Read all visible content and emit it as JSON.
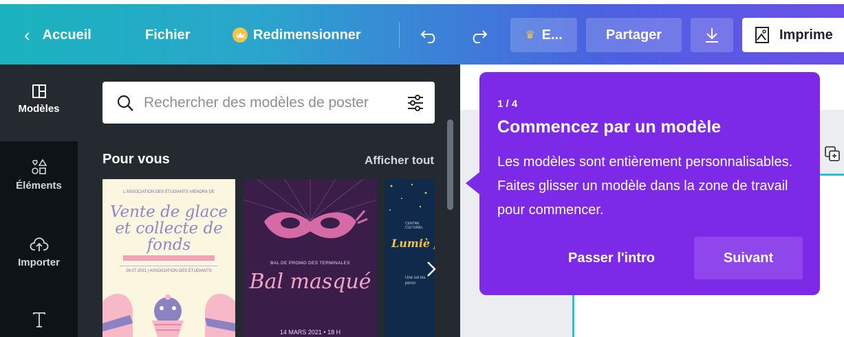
{
  "topbar": {
    "back_label": "Accueil",
    "file_label": "Fichier",
    "resize_label": "Redimensionner",
    "e_label": "E...",
    "share_label": "Partager",
    "print_label": "Imprime"
  },
  "rail": {
    "items": [
      {
        "label": "Modèles",
        "icon": "templates-icon"
      },
      {
        "label": "Éléments",
        "icon": "elements-icon"
      },
      {
        "label": "Importer",
        "icon": "upload-cloud-icon"
      },
      {
        "label": "",
        "icon": "text-icon"
      }
    ]
  },
  "panel": {
    "search_placeholder": "Rechercher des modèles de poster",
    "section_title": "Pour vous",
    "see_all": "Afficher tout",
    "templates": [
      {
        "top_small": "L'ASSOCIATION DES ÉTUDIANTS VIENDRA DE",
        "script": "Vente de glace et collecte de fonds",
        "info": "26.07.2021 | ASSOCIATION DES ÉTUDIANTS"
      },
      {
        "subtitle": "BAL DE PROMO DES TERMINALES",
        "title": "Bal masqué",
        "date": "14 MARS 2021 • 18 H"
      },
      {
        "small": "CENTRE CULTUREL",
        "title": "Lumiè faib",
        "body": "Une soi les perso"
      }
    ]
  },
  "tooltip": {
    "step": "1 / 4",
    "title": "Commencez par un modèle",
    "body": "Les modèles sont entièrement personnalisables. Faites glisser un modèle dans la zone de travail pour commencer.",
    "skip_label": "Passer l'intro",
    "next_label": "Suivant"
  },
  "colors": {
    "gradient_start": "#1ab3bd",
    "gradient_end": "#6a4fe8",
    "tooltip_bg": "#7d2ae8",
    "rail_bg": "#0e1318",
    "panel_bg": "#252a31",
    "page_outline": "#25c3d0"
  }
}
